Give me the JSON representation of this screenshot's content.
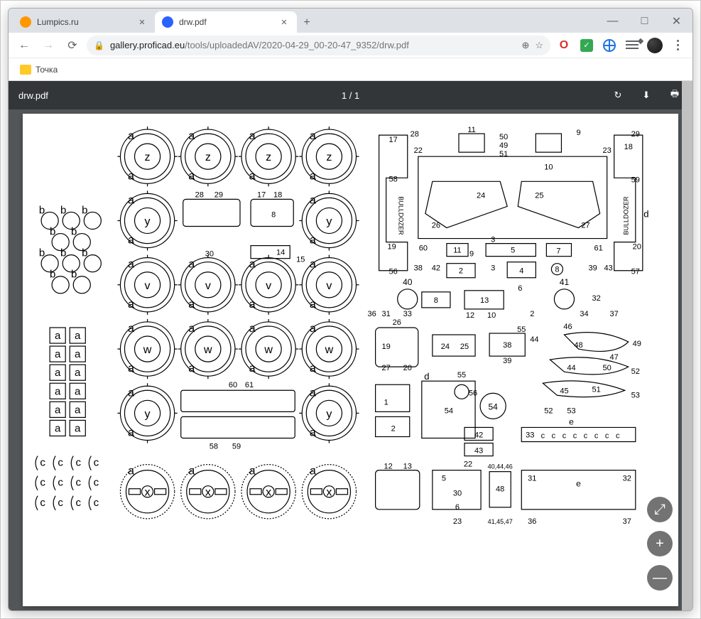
{
  "window": {
    "tabs": [
      {
        "title": "Lumpics.ru",
        "active": false
      },
      {
        "title": "drw.pdf",
        "active": true
      }
    ]
  },
  "address": {
    "host": "gallery.proficad.eu",
    "path": "/tools/uploadedAV/2020-04-29_00-20-47_9352/drw.pdf"
  },
  "bookmarks": {
    "item1": "Точка"
  },
  "pdf": {
    "filename": "drw.pdf",
    "page_indicator": "1 / 1",
    "content_label": "BULLDOZER",
    "gear_labels": {
      "z": "z",
      "y": "y",
      "v": "v",
      "w": "w",
      "x": "x"
    },
    "tag": "a",
    "tag_b": "b",
    "tag_c": "c",
    "tag_d": "d",
    "tag_e": "e",
    "part_nums": {
      "n1": "1",
      "n2": "2",
      "n3": "3",
      "n4": "4",
      "n5": "5",
      "n6": "6",
      "n7": "7",
      "n8": "8",
      "n9": "9",
      "n10": "10",
      "n11": "11",
      "n12": "12",
      "n13": "13",
      "n14": "14",
      "n15": "15",
      "n17": "17",
      "n18": "18",
      "n19": "19",
      "n20": "20",
      "n22": "22",
      "n23": "23",
      "n24": "24",
      "n25": "25",
      "n26": "26",
      "n27": "27",
      "n28": "28",
      "n29": "29",
      "n30": "30",
      "n31": "31",
      "n32": "32",
      "n33": "33",
      "n34": "34",
      "n36": "36",
      "n37": "37",
      "n38": "38",
      "n39": "39",
      "n40": "40",
      "n41": "41",
      "n42": "42",
      "n43": "43",
      "n44": "44",
      "n45": "45",
      "n46": "46",
      "n47": "47",
      "n48": "48",
      "n49": "49",
      "n50": "50",
      "n51": "51",
      "n52": "52",
      "n53": "53",
      "n54": "54",
      "n55": "55",
      "n56": "56",
      "n57": "57",
      "n58": "58",
      "n59": "59",
      "n60": "60",
      "n61": "61",
      "n40set": "40,44,46",
      "n41set": "41,45,47"
    }
  },
  "icons": {
    "close": "✕",
    "plus": "+",
    "minimize": "—",
    "maximize": "□",
    "back": "←",
    "forward": "→",
    "reload": "⟳",
    "lock": "🔒",
    "zoom": "⊕",
    "star": "☆",
    "check": "✓",
    "download": "⬇",
    "print": "🖶",
    "rotate": "↻",
    "fit": "⤢"
  }
}
